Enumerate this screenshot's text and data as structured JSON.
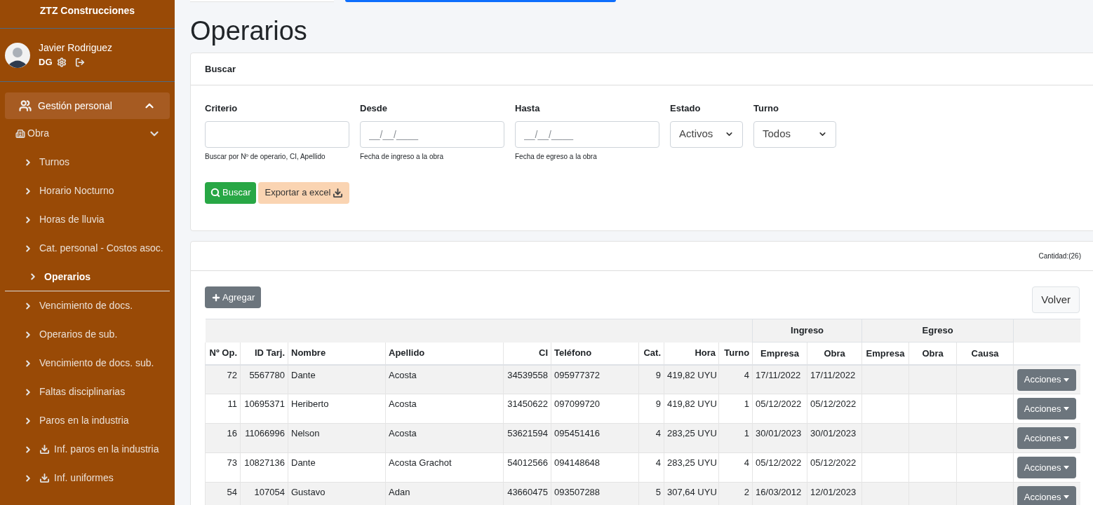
{
  "sidebar": {
    "brand": "ZTZ Construcciones",
    "user": {
      "name": "Javier Rodriguez",
      "role": "DG"
    },
    "menu": [
      {
        "label": "Gestión personal",
        "expanded": true,
        "children": [
          {
            "label": "Obra",
            "children": [
              {
                "label": "Turnos",
                "kind": "link",
                "selected": false
              },
              {
                "label": "Horario Nocturno",
                "kind": "link",
                "selected": false
              },
              {
                "label": "Horas de lluvia",
                "kind": "link",
                "selected": false
              },
              {
                "label": "Cat. personal - Costos asoc.",
                "kind": "link",
                "selected": false
              },
              {
                "label": "Operarios",
                "kind": "link",
                "selected": true
              },
              {
                "label": "Vencimiento de docs.",
                "kind": "link",
                "selected": false
              },
              {
                "label": "Operarios de sub.",
                "kind": "link",
                "selected": false
              },
              {
                "label": "Vencimiento de docs. sub.",
                "kind": "link",
                "selected": false
              },
              {
                "label": "Faltas disciplinarias",
                "kind": "link",
                "selected": false
              },
              {
                "label": "Paros en la industria",
                "kind": "link",
                "selected": false
              },
              {
                "label": "Inf. paros en la industria",
                "kind": "download",
                "selected": false
              },
              {
                "label": "Inf. uniformes",
                "kind": "download",
                "selected": false
              }
            ]
          }
        ]
      }
    ]
  },
  "page_title": "Operarios",
  "search_card": {
    "title": "Buscar",
    "fields": [
      {
        "kind": "text",
        "label": "Criterio",
        "help": "Buscar por Nº de operario, CI, Apellido"
      },
      {
        "kind": "date",
        "label": "Desde",
        "placeholder": "__/__/____",
        "help": "Fecha de ingreso a la obra"
      },
      {
        "kind": "date",
        "label": "Hasta",
        "placeholder": "__/__/____",
        "help": "Fecha de egreso a la obra"
      },
      {
        "kind": "select",
        "label": "Estado",
        "value": "Activos"
      },
      {
        "kind": "select",
        "label": "Turno",
        "value": "Todos"
      }
    ],
    "buttons": [
      {
        "kind": "search",
        "label": "Buscar"
      },
      {
        "kind": "export",
        "label": "Exportar a excel"
      }
    ]
  },
  "list_card": {
    "count": "Cantidad:(26)",
    "add_button": "Agregar",
    "back_button": "Volver",
    "table": {
      "groups": [
        {
          "label": "Ingreso"
        },
        {
          "label": "Egreso"
        }
      ],
      "columns": [
        "Nº Op.",
        "ID Tarj.",
        "Nombre",
        "Apellido",
        "CI",
        "Teléfono",
        "Cat.",
        "Hora",
        "Turno",
        "Empresa",
        "Obra",
        "Empresa",
        "Obra",
        "Causa"
      ],
      "rows": [
        {
          "cells": [
            "72",
            "5567780",
            "Dante",
            "Acosta",
            "34539558",
            "095977372",
            "9",
            "419,82 UYU",
            "4",
            "17/11/2022",
            "17/11/2022",
            "",
            "",
            ""
          ],
          "action": "Acciones"
        },
        {
          "cells": [
            "11",
            "10695371",
            "Heriberto",
            "Acosta",
            "31450622",
            "097099720",
            "9",
            "419,82 UYU",
            "1",
            "05/12/2022",
            "05/12/2022",
            "",
            "",
            ""
          ],
          "action": "Acciones"
        },
        {
          "cells": [
            "16",
            "11066996",
            "Nelson",
            "Acosta",
            "53621594",
            "095451416",
            "4",
            "283,25 UYU",
            "1",
            "30/01/2023",
            "30/01/2023",
            "",
            "",
            ""
          ],
          "action": "Acciones"
        },
        {
          "cells": [
            "73",
            "10827136",
            "Dante",
            "Acosta Grachot",
            "54012566",
            "094148648",
            "4",
            "283,25 UYU",
            "4",
            "05/12/2022",
            "05/12/2022",
            "",
            "",
            ""
          ],
          "action": "Acciones"
        },
        {
          "cells": [
            "54",
            "107054",
            "Gustavo",
            "Adan",
            "43660475",
            "093507288",
            "5",
            "307,64 UYU",
            "2",
            "16/03/2012",
            "12/01/2023",
            "",
            "",
            ""
          ],
          "action": "Acciones"
        }
      ]
    }
  }
}
